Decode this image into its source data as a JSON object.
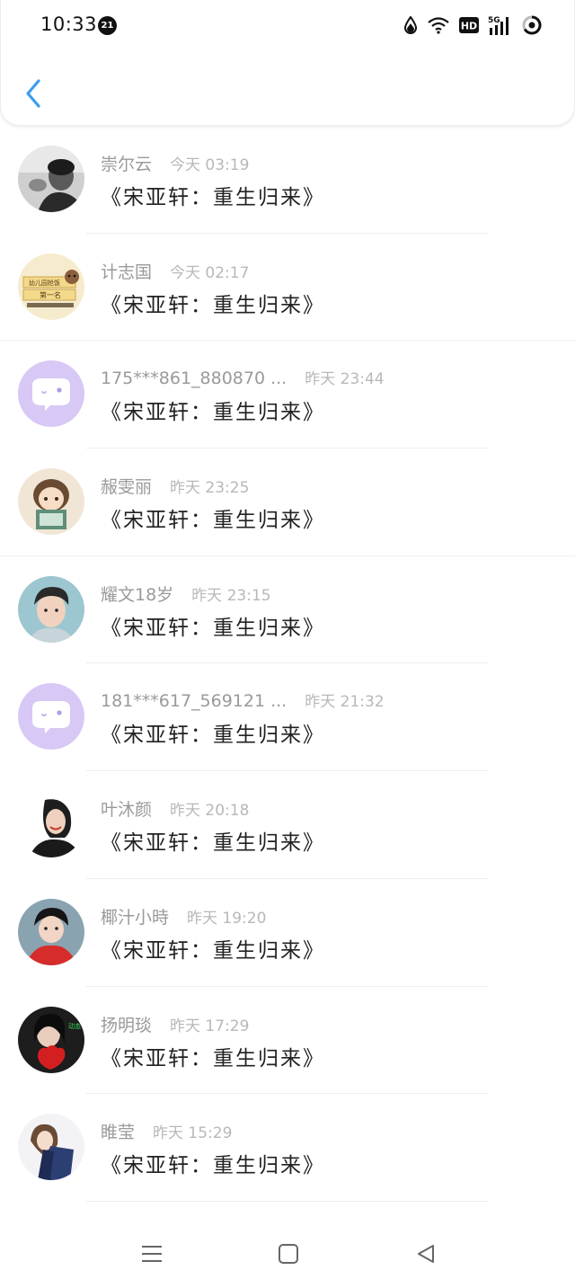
{
  "status_bar": {
    "time": "10:33",
    "notification_count": "21",
    "icons": [
      "drop-icon",
      "wifi-icon",
      "hd-icon",
      "signal-5g-icon",
      "battery-ring-icon"
    ],
    "hd_label": "HD",
    "network_label": "5G"
  },
  "header": {
    "back_icon": "chevron-left-icon",
    "accent_color": "#3a9df0"
  },
  "list": {
    "items": [
      {
        "username": "崇尔云",
        "timestamp": "今天 03:19",
        "message": "《宋亚轩：重生归来》",
        "avatar": "photo"
      },
      {
        "username": "计志国",
        "timestamp": "今天 02:17",
        "message": "《宋亚轩：重生归来》",
        "avatar": "sticker"
      },
      {
        "username": "175***861_880870 ...",
        "timestamp": "昨天 23:44",
        "message": "《宋亚轩：重生归来》",
        "avatar": "default-chat"
      },
      {
        "username": "赧雯丽",
        "timestamp": "昨天 23:25",
        "message": "《宋亚轩：重生归来》",
        "avatar": "anime"
      },
      {
        "username": "耀文18岁",
        "timestamp": "昨天 23:15",
        "message": "《宋亚轩：重生归来》",
        "avatar": "photo"
      },
      {
        "username": "181***617_569121 ...",
        "timestamp": "昨天 21:32",
        "message": "《宋亚轩：重生归来》",
        "avatar": "default-chat"
      },
      {
        "username": "叶沐颜",
        "timestamp": "昨天 20:18",
        "message": "《宋亚轩：重生归来》",
        "avatar": "photo"
      },
      {
        "username": "椰汁小時",
        "timestamp": "昨天 19:20",
        "message": "《宋亚轩：重生归来》",
        "avatar": "photo"
      },
      {
        "username": "扬明琰",
        "timestamp": "昨天 17:29",
        "message": "《宋亚轩：重生归来》",
        "avatar": "photo"
      },
      {
        "username": "睢莹",
        "timestamp": "昨天 15:29",
        "message": "《宋亚轩：重生归来》",
        "avatar": "anime"
      }
    ]
  },
  "nav_bar": {
    "icons": [
      "menu-icon",
      "home-icon",
      "back-triangle-icon"
    ]
  },
  "colors": {
    "default_avatar_bg": "#d8c8f5",
    "username": "#9a9a9a",
    "timestamp": "#b8b8b8"
  }
}
